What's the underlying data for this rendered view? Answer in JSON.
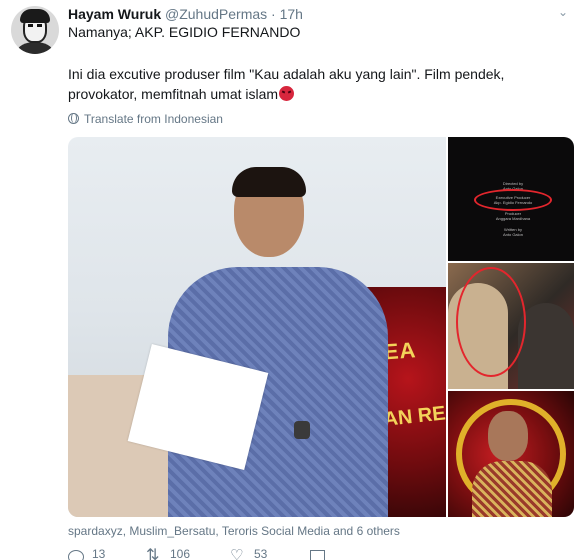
{
  "tweet": {
    "author_name": "Hayam Wuruk",
    "author_handle": "@ZuhudPermas",
    "separator": "·",
    "time": "17h",
    "line1": "Namanya; AKP. EGIDIO FERNANDO",
    "line2": "Ini dia excutive produser film \"Kau adalah aku yang lain\". Film pendek, provokator, memfitnah umat islam",
    "translate_label": "Translate from Indonesian",
    "likers": "spardaxyz, Muslim_Bersatu, Teroris Social Media and 6 others"
  },
  "media": {
    "main_photo_banner_top": "SS RELEA",
    "main_photo_banner_bottom": "JUAN RE",
    "credits_image_lines": [
      "Directed by",
      "Anto Galon",
      "Executive Producer",
      "Akp. Egidio Fernando",
      "Producer",
      "Anggara Mardhana",
      "Written by",
      "Anto Galon"
    ]
  },
  "actions": {
    "reply_count": "13",
    "retweet_count": "106",
    "like_count": "53"
  },
  "icons": {
    "more": "chevron-down-icon",
    "translate": "globe-icon",
    "reply": "reply-icon",
    "retweet": "retweet-icon",
    "like": "heart-icon",
    "dm": "envelope-icon",
    "emoji": "angry-face-icon"
  },
  "colors": {
    "text": "#14171a",
    "muted": "#657786",
    "emoji": "#d7263d",
    "highlight_ring": "#e3262d"
  }
}
